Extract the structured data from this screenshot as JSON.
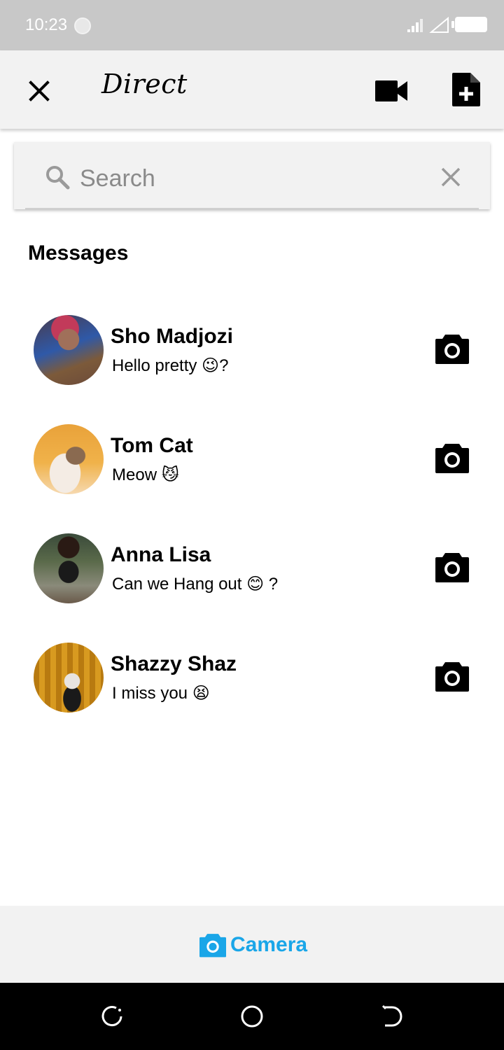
{
  "status_bar": {
    "time": "10:23"
  },
  "app_bar": {
    "title": "Direct"
  },
  "search": {
    "placeholder": "Search",
    "value": ""
  },
  "section": {
    "heading": "Messages"
  },
  "chats": [
    {
      "name": "Sho Madjozi",
      "preview": "Hello pretty 😉?"
    },
    {
      "name": "Tom Cat",
      "preview": "Meow 😼"
    },
    {
      "name": "Anna Lisa",
      "preview": "Can we Hang out 😊 ?"
    },
    {
      "name": "Shazzy Shaz",
      "preview": "I miss you 😫"
    }
  ],
  "bottom_bar": {
    "camera_label": "Camera"
  },
  "colors": {
    "accent": "#1aa6e8",
    "appbar_bg": "#f2f2f2",
    "statusbar_bg": "#c8c8c8"
  },
  "icons": [
    "close-icon",
    "video-camera-icon",
    "new-document-icon",
    "search-icon",
    "clear-icon",
    "camera-icon",
    "recents-icon",
    "home-icon",
    "back-icon"
  ]
}
